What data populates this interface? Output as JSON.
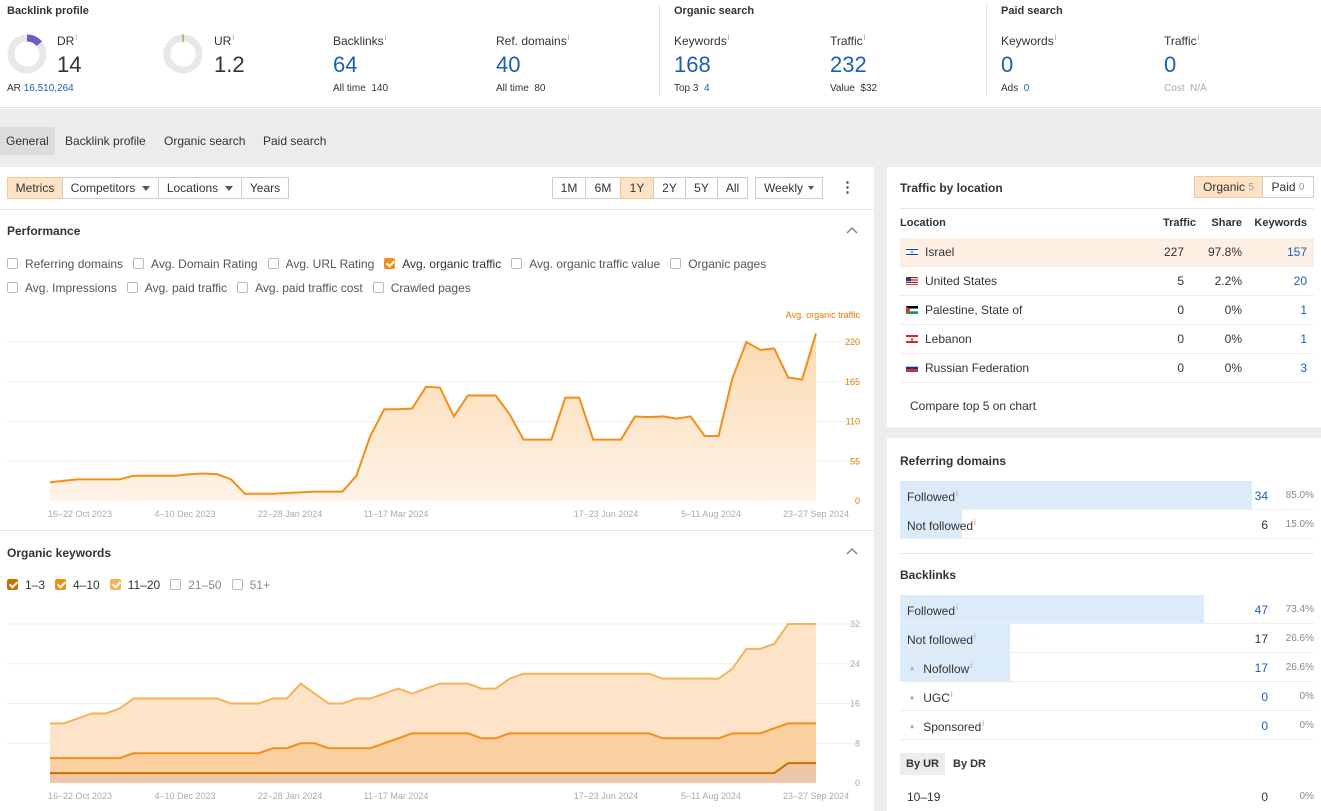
{
  "header": {
    "backlink_profile": {
      "title": "Backlink profile",
      "dr": {
        "label": "DR",
        "value": "14",
        "ar_label": "AR",
        "ar_value": "16,510,264"
      },
      "ur": {
        "label": "UR",
        "value": "1.2"
      },
      "backlinks": {
        "label": "Backlinks",
        "value": "64",
        "sub_label": "All time",
        "sub_value": "140"
      },
      "ref_domains": {
        "label": "Ref. domains",
        "value": "40",
        "sub_label": "All time",
        "sub_value": "80"
      }
    },
    "organic_search": {
      "title": "Organic search",
      "keywords": {
        "label": "Keywords",
        "value": "168",
        "sub_label": "Top 3",
        "sub_value": "4"
      },
      "traffic": {
        "label": "Traffic",
        "value": "232",
        "sub_label": "Value",
        "sub_value": "$32"
      }
    },
    "paid_search": {
      "title": "Paid search",
      "keywords": {
        "label": "Keywords",
        "value": "0",
        "sub_label": "Ads",
        "sub_value": "0"
      },
      "traffic": {
        "label": "Traffic",
        "value": "0",
        "sub_label": "Cost",
        "sub_value": "N/A"
      }
    },
    "info_icon": "i"
  },
  "tabs": [
    "General",
    "Backlink profile",
    "Organic search",
    "Paid search"
  ],
  "toolbar": {
    "metrics": "Metrics",
    "competitors": "Competitors",
    "locations": "Locations",
    "years": "Years",
    "ranges": [
      "1M",
      "6M",
      "1Y",
      "2Y",
      "5Y",
      "All"
    ],
    "selected_range": "1Y",
    "interval": "Weekly",
    "more_icon": "⋮"
  },
  "performance": {
    "title": "Performance",
    "checkboxes_row1": [
      {
        "label": "Referring domains",
        "checked": false
      },
      {
        "label": "Avg. Domain Rating",
        "checked": false
      },
      {
        "label": "Avg. URL Rating",
        "checked": false
      },
      {
        "label": "Avg. organic traffic",
        "checked": true
      },
      {
        "label": "Avg. organic traffic value",
        "checked": false
      },
      {
        "label": "Organic pages",
        "checked": false
      }
    ],
    "checkboxes_row2": [
      {
        "label": "Avg. Impressions",
        "checked": false
      },
      {
        "label": "Avg. paid traffic",
        "checked": false
      },
      {
        "label": "Avg. paid traffic cost",
        "checked": false
      },
      {
        "label": "Crawled pages",
        "checked": false
      }
    ],
    "series_label": "Avg. organic traffic",
    "accent": "#f0901a"
  },
  "organic_keywords": {
    "title": "Organic keywords",
    "checkboxes": [
      {
        "label": "1–3",
        "checked": true,
        "color": "#c97000"
      },
      {
        "label": "4–10",
        "checked": true,
        "color": "#f0901a"
      },
      {
        "label": "11–20",
        "checked": true,
        "color": "#f7b259"
      },
      {
        "label": "21–50",
        "checked": false
      },
      {
        "label": "51+",
        "checked": false
      }
    ]
  },
  "chart_data": [
    {
      "type": "area",
      "x_tick_labels": [
        "16–22 Oct 2023",
        "4–10 Dec 2023",
        "22–28 Jan 2024",
        "11–17 Mar 2024",
        "17–23 Jun 2024",
        "5–11 Aug 2024",
        "23–27 Sep 2024"
      ],
      "y_ticks": [
        0,
        55,
        110,
        165,
        220
      ],
      "ylim": [
        0,
        220
      ],
      "series": [
        {
          "name": "Avg. organic traffic",
          "color": "#f0901a",
          "values": [
            26,
            28,
            30,
            30,
            30,
            30,
            35,
            35,
            35,
            35,
            37,
            38,
            37,
            30,
            10,
            10,
            10,
            11,
            12,
            13,
            13,
            13,
            35,
            90,
            127,
            127,
            128,
            158,
            157,
            117,
            146,
            146,
            146,
            120,
            85,
            85,
            85,
            143,
            143,
            85,
            85,
            85,
            117,
            116,
            117,
            114,
            117,
            90,
            90,
            170,
            220,
            209,
            211,
            171,
            168,
            232
          ]
        }
      ]
    },
    {
      "type": "area",
      "x_tick_labels": [
        "16–22 Oct 2023",
        "4–10 Dec 2023",
        "22–28 Jan 2024",
        "11–17 Mar 2024",
        "17–23 Jun 2024",
        "5–11 Aug 2024",
        "23–27 Sep 2024"
      ],
      "y_ticks": [
        0,
        8,
        16,
        24,
        32
      ],
      "ylim": [
        0,
        32
      ],
      "stacked": true,
      "series": [
        {
          "name": "1–3",
          "color": "#c97000",
          "values": [
            2,
            2,
            2,
            2,
            2,
            2,
            2,
            2,
            2,
            2,
            2,
            2,
            2,
            2,
            2,
            2,
            2,
            2,
            2,
            2,
            2,
            2,
            2,
            2,
            2,
            2,
            2,
            2,
            2,
            2,
            2,
            2,
            2,
            2,
            2,
            2,
            2,
            2,
            2,
            2,
            2,
            2,
            2,
            2,
            2,
            2,
            2,
            2,
            2,
            2,
            2,
            2,
            2,
            4,
            4,
            4
          ]
        },
        {
          "name": "4–10",
          "color": "#f0901a",
          "values": [
            3,
            3,
            3,
            3,
            3,
            3,
            4,
            4,
            4,
            4,
            4,
            4,
            4,
            4,
            4,
            4,
            5,
            5,
            6,
            6,
            5,
            5,
            5,
            5,
            6,
            7,
            8,
            8,
            8,
            8,
            8,
            7,
            7,
            8,
            8,
            8,
            8,
            8,
            8,
            8,
            8,
            8,
            8,
            8,
            7,
            7,
            7,
            7,
            7,
            8,
            8,
            8,
            9,
            8,
            8,
            8
          ]
        },
        {
          "name": "11–20",
          "color": "#f7b259",
          "values": [
            7,
            7,
            8,
            9,
            9,
            10,
            11,
            11,
            11,
            11,
            11,
            11,
            11,
            10,
            10,
            10,
            10,
            10,
            12,
            10,
            9,
            9,
            10,
            10,
            10,
            10,
            8,
            9,
            10,
            10,
            10,
            10,
            10,
            11,
            12,
            12,
            12,
            12,
            12,
            12,
            12,
            12,
            12,
            12,
            12,
            12,
            12,
            12,
            12,
            13,
            17,
            17,
            17,
            20,
            20,
            20
          ]
        }
      ]
    }
  ],
  "traffic_by_location": {
    "title": "Traffic by location",
    "organic_label": "Organic",
    "organic_count": "5",
    "paid_label": "Paid",
    "paid_count": "0",
    "columns": [
      "Location",
      "Traffic",
      "Share",
      "Keywords"
    ],
    "rows": [
      {
        "location": "Israel",
        "traffic": "227",
        "share": "97.8%",
        "keywords": "157",
        "flag": "il",
        "highlight": true
      },
      {
        "location": "United States",
        "traffic": "5",
        "share": "2.2%",
        "keywords": "20",
        "flag": "us"
      },
      {
        "location": "Palestine, State of",
        "traffic": "0",
        "share": "0%",
        "keywords": "1",
        "flag": "ps"
      },
      {
        "location": "Lebanon",
        "traffic": "0",
        "share": "0%",
        "keywords": "1",
        "flag": "lb"
      },
      {
        "location": "Russian Federation",
        "traffic": "0",
        "share": "0%",
        "keywords": "3",
        "flag": "ru"
      }
    ],
    "compare_label": "Compare top 5 on chart"
  },
  "referring_domains": {
    "title": "Referring domains",
    "rows": [
      {
        "label": "Followed",
        "value": "34",
        "pct": "85.0%",
        "fraction": 0.85,
        "blue": true
      },
      {
        "label": "Not followed",
        "value": "6",
        "pct": "15.0%",
        "fraction": 0.15,
        "blue": false
      }
    ]
  },
  "backlinks": {
    "title": "Backlinks",
    "rows": [
      {
        "label": "Followed",
        "value": "47",
        "pct": "73.4%",
        "fraction": 0.734,
        "blue": true,
        "info": true
      },
      {
        "label": "Not followed",
        "value": "17",
        "pct": "26.6%",
        "fraction": 0.266,
        "blue": false,
        "info": true
      },
      {
        "label": "Nofollow",
        "value": "17",
        "pct": "26.6%",
        "fraction": 0.266,
        "blue": true,
        "sub": true,
        "info": true
      },
      {
        "label": "UGC",
        "value": "0",
        "pct": "0%",
        "fraction": 0,
        "blue": true,
        "sub": true,
        "info": true
      },
      {
        "label": "Sponsored",
        "value": "0",
        "pct": "0%",
        "fraction": 0,
        "blue": true,
        "sub": true,
        "info": true
      }
    ],
    "by_ur": "By UR",
    "by_dr": "By DR",
    "ur_row": {
      "label": "10–19",
      "value": "0",
      "pct": "0%"
    }
  }
}
